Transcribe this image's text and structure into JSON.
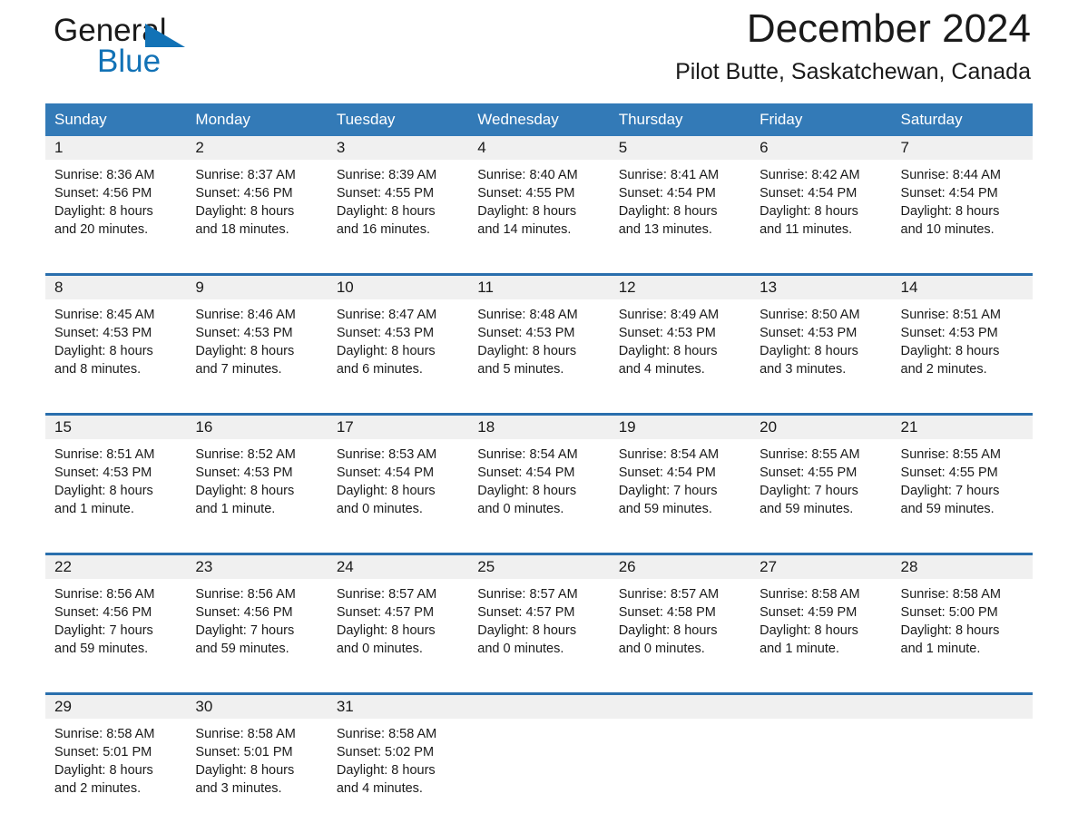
{
  "brand": {
    "name_part1": "General",
    "name_part2": "Blue",
    "logo_color": "#1272b6"
  },
  "header": {
    "month_title": "December 2024",
    "location": "Pilot Butte, Saskatchewan, Canada",
    "accent_color": "#337ab7"
  },
  "calendar": {
    "weekday_headers": [
      "Sunday",
      "Monday",
      "Tuesday",
      "Wednesday",
      "Thursday",
      "Friday",
      "Saturday"
    ],
    "weeks": [
      [
        {
          "day": "1",
          "sunrise": "Sunrise: 8:36 AM",
          "sunset": "Sunset: 4:56 PM",
          "daylight_1": "Daylight: 8 hours",
          "daylight_2": "and 20 minutes."
        },
        {
          "day": "2",
          "sunrise": "Sunrise: 8:37 AM",
          "sunset": "Sunset: 4:56 PM",
          "daylight_1": "Daylight: 8 hours",
          "daylight_2": "and 18 minutes."
        },
        {
          "day": "3",
          "sunrise": "Sunrise: 8:39 AM",
          "sunset": "Sunset: 4:55 PM",
          "daylight_1": "Daylight: 8 hours",
          "daylight_2": "and 16 minutes."
        },
        {
          "day": "4",
          "sunrise": "Sunrise: 8:40 AM",
          "sunset": "Sunset: 4:55 PM",
          "daylight_1": "Daylight: 8 hours",
          "daylight_2": "and 14 minutes."
        },
        {
          "day": "5",
          "sunrise": "Sunrise: 8:41 AM",
          "sunset": "Sunset: 4:54 PM",
          "daylight_1": "Daylight: 8 hours",
          "daylight_2": "and 13 minutes."
        },
        {
          "day": "6",
          "sunrise": "Sunrise: 8:42 AM",
          "sunset": "Sunset: 4:54 PM",
          "daylight_1": "Daylight: 8 hours",
          "daylight_2": "and 11 minutes."
        },
        {
          "day": "7",
          "sunrise": "Sunrise: 8:44 AM",
          "sunset": "Sunset: 4:54 PM",
          "daylight_1": "Daylight: 8 hours",
          "daylight_2": "and 10 minutes."
        }
      ],
      [
        {
          "day": "8",
          "sunrise": "Sunrise: 8:45 AM",
          "sunset": "Sunset: 4:53 PM",
          "daylight_1": "Daylight: 8 hours",
          "daylight_2": "and 8 minutes."
        },
        {
          "day": "9",
          "sunrise": "Sunrise: 8:46 AM",
          "sunset": "Sunset: 4:53 PM",
          "daylight_1": "Daylight: 8 hours",
          "daylight_2": "and 7 minutes."
        },
        {
          "day": "10",
          "sunrise": "Sunrise: 8:47 AM",
          "sunset": "Sunset: 4:53 PM",
          "daylight_1": "Daylight: 8 hours",
          "daylight_2": "and 6 minutes."
        },
        {
          "day": "11",
          "sunrise": "Sunrise: 8:48 AM",
          "sunset": "Sunset: 4:53 PM",
          "daylight_1": "Daylight: 8 hours",
          "daylight_2": "and 5 minutes."
        },
        {
          "day": "12",
          "sunrise": "Sunrise: 8:49 AM",
          "sunset": "Sunset: 4:53 PM",
          "daylight_1": "Daylight: 8 hours",
          "daylight_2": "and 4 minutes."
        },
        {
          "day": "13",
          "sunrise": "Sunrise: 8:50 AM",
          "sunset": "Sunset: 4:53 PM",
          "daylight_1": "Daylight: 8 hours",
          "daylight_2": "and 3 minutes."
        },
        {
          "day": "14",
          "sunrise": "Sunrise: 8:51 AM",
          "sunset": "Sunset: 4:53 PM",
          "daylight_1": "Daylight: 8 hours",
          "daylight_2": "and 2 minutes."
        }
      ],
      [
        {
          "day": "15",
          "sunrise": "Sunrise: 8:51 AM",
          "sunset": "Sunset: 4:53 PM",
          "daylight_1": "Daylight: 8 hours",
          "daylight_2": "and 1 minute."
        },
        {
          "day": "16",
          "sunrise": "Sunrise: 8:52 AM",
          "sunset": "Sunset: 4:53 PM",
          "daylight_1": "Daylight: 8 hours",
          "daylight_2": "and 1 minute."
        },
        {
          "day": "17",
          "sunrise": "Sunrise: 8:53 AM",
          "sunset": "Sunset: 4:54 PM",
          "daylight_1": "Daylight: 8 hours",
          "daylight_2": "and 0 minutes."
        },
        {
          "day": "18",
          "sunrise": "Sunrise: 8:54 AM",
          "sunset": "Sunset: 4:54 PM",
          "daylight_1": "Daylight: 8 hours",
          "daylight_2": "and 0 minutes."
        },
        {
          "day": "19",
          "sunrise": "Sunrise: 8:54 AM",
          "sunset": "Sunset: 4:54 PM",
          "daylight_1": "Daylight: 7 hours",
          "daylight_2": "and 59 minutes."
        },
        {
          "day": "20",
          "sunrise": "Sunrise: 8:55 AM",
          "sunset": "Sunset: 4:55 PM",
          "daylight_1": "Daylight: 7 hours",
          "daylight_2": "and 59 minutes."
        },
        {
          "day": "21",
          "sunrise": "Sunrise: 8:55 AM",
          "sunset": "Sunset: 4:55 PM",
          "daylight_1": "Daylight: 7 hours",
          "daylight_2": "and 59 minutes."
        }
      ],
      [
        {
          "day": "22",
          "sunrise": "Sunrise: 8:56 AM",
          "sunset": "Sunset: 4:56 PM",
          "daylight_1": "Daylight: 7 hours",
          "daylight_2": "and 59 minutes."
        },
        {
          "day": "23",
          "sunrise": "Sunrise: 8:56 AM",
          "sunset": "Sunset: 4:56 PM",
          "daylight_1": "Daylight: 7 hours",
          "daylight_2": "and 59 minutes."
        },
        {
          "day": "24",
          "sunrise": "Sunrise: 8:57 AM",
          "sunset": "Sunset: 4:57 PM",
          "daylight_1": "Daylight: 8 hours",
          "daylight_2": "and 0 minutes."
        },
        {
          "day": "25",
          "sunrise": "Sunrise: 8:57 AM",
          "sunset": "Sunset: 4:57 PM",
          "daylight_1": "Daylight: 8 hours",
          "daylight_2": "and 0 minutes."
        },
        {
          "day": "26",
          "sunrise": "Sunrise: 8:57 AM",
          "sunset": "Sunset: 4:58 PM",
          "daylight_1": "Daylight: 8 hours",
          "daylight_2": "and 0 minutes."
        },
        {
          "day": "27",
          "sunrise": "Sunrise: 8:58 AM",
          "sunset": "Sunset: 4:59 PM",
          "daylight_1": "Daylight: 8 hours",
          "daylight_2": "and 1 minute."
        },
        {
          "day": "28",
          "sunrise": "Sunrise: 8:58 AM",
          "sunset": "Sunset: 5:00 PM",
          "daylight_1": "Daylight: 8 hours",
          "daylight_2": "and 1 minute."
        }
      ],
      [
        {
          "day": "29",
          "sunrise": "Sunrise: 8:58 AM",
          "sunset": "Sunset: 5:01 PM",
          "daylight_1": "Daylight: 8 hours",
          "daylight_2": "and 2 minutes."
        },
        {
          "day": "30",
          "sunrise": "Sunrise: 8:58 AM",
          "sunset": "Sunset: 5:01 PM",
          "daylight_1": "Daylight: 8 hours",
          "daylight_2": "and 3 minutes."
        },
        {
          "day": "31",
          "sunrise": "Sunrise: 8:58 AM",
          "sunset": "Sunset: 5:02 PM",
          "daylight_1": "Daylight: 8 hours",
          "daylight_2": "and 4 minutes."
        },
        {
          "day": "",
          "sunrise": "",
          "sunset": "",
          "daylight_1": "",
          "daylight_2": ""
        },
        {
          "day": "",
          "sunrise": "",
          "sunset": "",
          "daylight_1": "",
          "daylight_2": ""
        },
        {
          "day": "",
          "sunrise": "",
          "sunset": "",
          "daylight_1": "",
          "daylight_2": ""
        },
        {
          "day": "",
          "sunrise": "",
          "sunset": "",
          "daylight_1": "",
          "daylight_2": ""
        }
      ]
    ]
  }
}
